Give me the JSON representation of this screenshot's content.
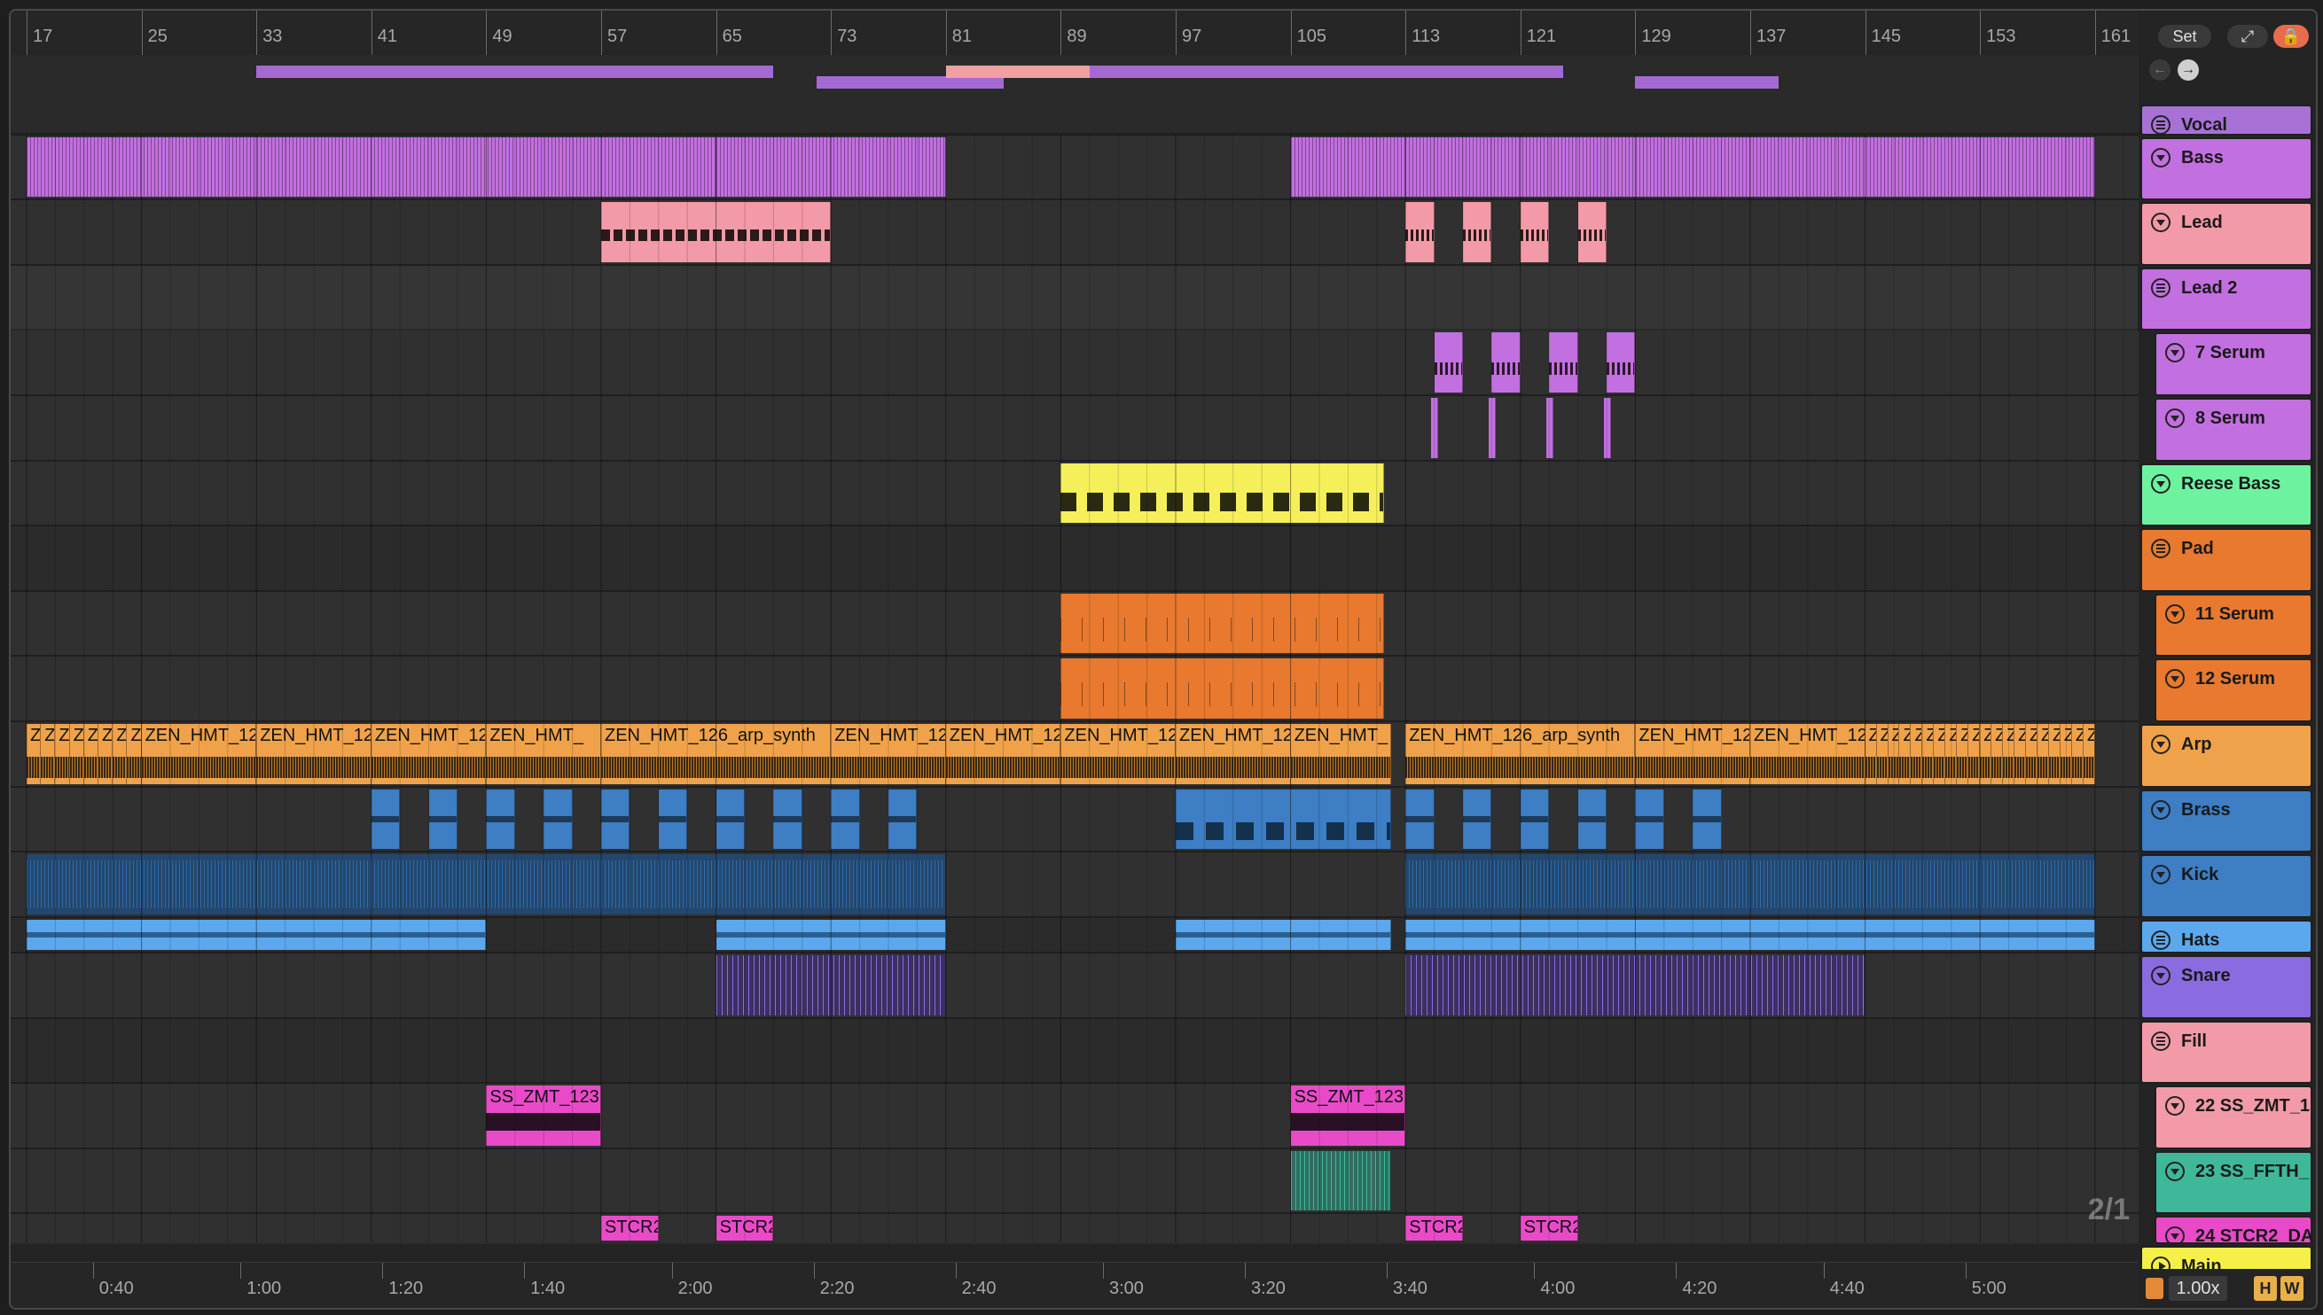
{
  "ruler": {
    "bars": [
      "17",
      "25",
      "33",
      "41",
      "49",
      "57",
      "65",
      "73",
      "81",
      "89",
      "97",
      "105",
      "113",
      "121",
      "129",
      "137",
      "145",
      "153",
      "161"
    ]
  },
  "timeline": {
    "times": [
      "0:40",
      "1:00",
      "1:20",
      "1:40",
      "2:00",
      "2:20",
      "2:40",
      "3:00",
      "3:20",
      "3:40",
      "4:00",
      "4:20",
      "4:40",
      "5:00"
    ]
  },
  "controls": {
    "set_label": "Set",
    "expand_icon": "⤢",
    "lock_icon": "🔒",
    "prev_icon": "←",
    "next_icon": "→",
    "zoom_ratio": "2/1",
    "tempo_factor": "1.00x",
    "h_label": "H",
    "w_label": "W",
    "meter_icon": "cpu-meter-icon"
  },
  "tracks": [
    {
      "name": "Vocal",
      "color": "#a871d6",
      "type": "group"
    },
    {
      "name": "Bass",
      "color": "#c26fe0",
      "type": "fold"
    },
    {
      "name": "Lead",
      "color": "#f29aa7",
      "type": "fold"
    },
    {
      "name": "Lead 2",
      "color": "#c26fe0",
      "type": "group"
    },
    {
      "name": "7 Serum",
      "color": "#c26fe0",
      "type": "fold",
      "sub": true
    },
    {
      "name": "8 Serum",
      "color": "#c26fe0",
      "type": "fold",
      "sub": true
    },
    {
      "name": "Reese Bass",
      "color": "#6df2a0",
      "type": "fold"
    },
    {
      "name": "Pad",
      "color": "#e8792f",
      "type": "group"
    },
    {
      "name": "11 Serum",
      "color": "#e8792f",
      "type": "fold",
      "sub": true
    },
    {
      "name": "12 Serum",
      "color": "#e8792f",
      "type": "fold",
      "sub": true
    },
    {
      "name": "Arp",
      "color": "#f0a24a",
      "type": "fold"
    },
    {
      "name": "Brass",
      "color": "#3d7ec4",
      "type": "fold"
    },
    {
      "name": "Kick",
      "color": "#3d7ec4",
      "type": "fold"
    },
    {
      "name": "Hats",
      "color": "#5ca8ee",
      "type": "group"
    },
    {
      "name": "Snare",
      "color": "#8a6ce0",
      "type": "fold"
    },
    {
      "name": "Fill",
      "color": "#f29aa7",
      "type": "group"
    },
    {
      "name": "22 SS_ZMT_1",
      "color": "#f29aa7",
      "type": "fold",
      "sub": true
    },
    {
      "name": "23 SS_FFTH_",
      "color": "#3fb89a",
      "type": "fold",
      "sub": true
    },
    {
      "name": "24 STCR2_DA",
      "color": "#e94bc8",
      "type": "fold",
      "sub": true
    },
    {
      "name": "Main",
      "color": "#f5f049",
      "type": "play"
    }
  ],
  "clips": {
    "arp": [
      "Z",
      "Z",
      "Z",
      "Z",
      "Z",
      "Z",
      "Z",
      "Z",
      "ZEN_HMT_12",
      "ZEN_HMT_12",
      "ZEN_HMT_12",
      "ZEN_HMT_",
      "ZEN_HMT_126_arp_synth",
      "ZEN_HMT_12",
      "ZEN_HMT_12",
      "ZEN_HMT_12",
      "ZEN_HMT_12",
      "ZEN_HMT_",
      "ZEN_HMT_126_arp_synth",
      "ZEN_HMT_12",
      "ZEN_HMT_12",
      "Z",
      "Z",
      "Z",
      "Z",
      "Z",
      "Z",
      "Z",
      "Z",
      "Z",
      "Z",
      "Z",
      "Z",
      "Z",
      "Z",
      "Z",
      "Z",
      "Z",
      "Z",
      "Z",
      "Z"
    ],
    "ss_zmt": [
      "SS_ZMT_123",
      "SS_ZMT_123"
    ],
    "stcr": [
      "STCR2",
      "STCR2",
      "STCR2",
      "STCR2"
    ]
  }
}
